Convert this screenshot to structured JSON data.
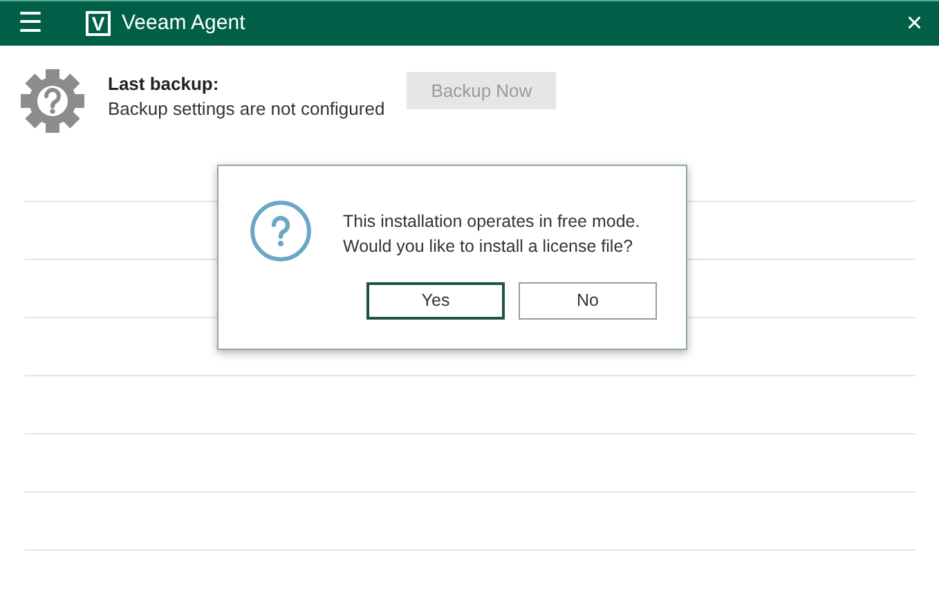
{
  "window": {
    "logo": "V",
    "title": "Veeam Agent",
    "menu_icon": "☰",
    "close": "×"
  },
  "status": {
    "heading": "Last backup:",
    "detail": "Backup settings are not configured",
    "action": {
      "label": "Backup Now",
      "disabled": true
    }
  },
  "dialog": {
    "message": [
      "This installation operates in free mode.",
      "Would you like to install a license file?"
    ],
    "buttons": [
      {
        "label": "Yes",
        "default": true
      },
      {
        "label": "No",
        "default": false
      }
    ]
  }
}
